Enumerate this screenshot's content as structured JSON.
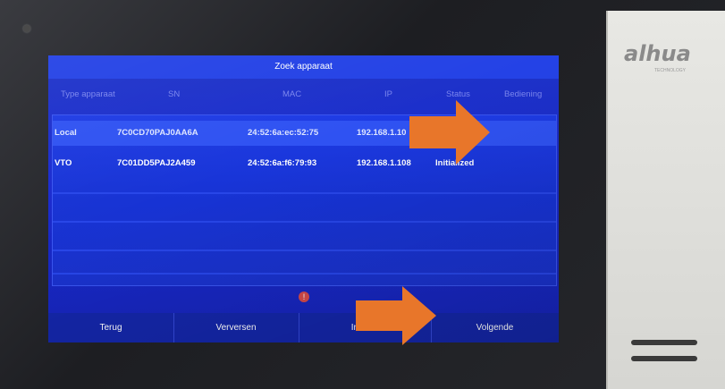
{
  "device": {
    "brand": "alhua",
    "brand_sub": "TECHNOLOGY"
  },
  "screen": {
    "title": "Zoek apparaat",
    "columns": [
      "Type apparaat",
      "SN",
      "MAC",
      "IP",
      "Status",
      "Bediening"
    ],
    "rows": [
      {
        "type": "Local",
        "sn": "7C0CD70PAJ0AA6A",
        "mac": "24:52:6a:ec:52:75",
        "ip": "192.168.1.10",
        "status": "",
        "selected": true
      },
      {
        "type": "VTO",
        "sn": "7C01DD5PAJ2A459",
        "mac": "24:52:6a:f6:79:93",
        "ip": "192.168.1.108",
        "status": "Initialized",
        "selected": false
      }
    ],
    "warning_icon": "alert-icon",
    "buttons": {
      "back": "Terug",
      "refresh": "Verversen",
      "initialize": "Initialis",
      "next": "Volgende"
    }
  },
  "colors": {
    "screen_blue": "#1a2bd0",
    "title_bar": "#2442e6",
    "selected_row": "#2f52f2",
    "arrow_orange": "#e8762a"
  }
}
